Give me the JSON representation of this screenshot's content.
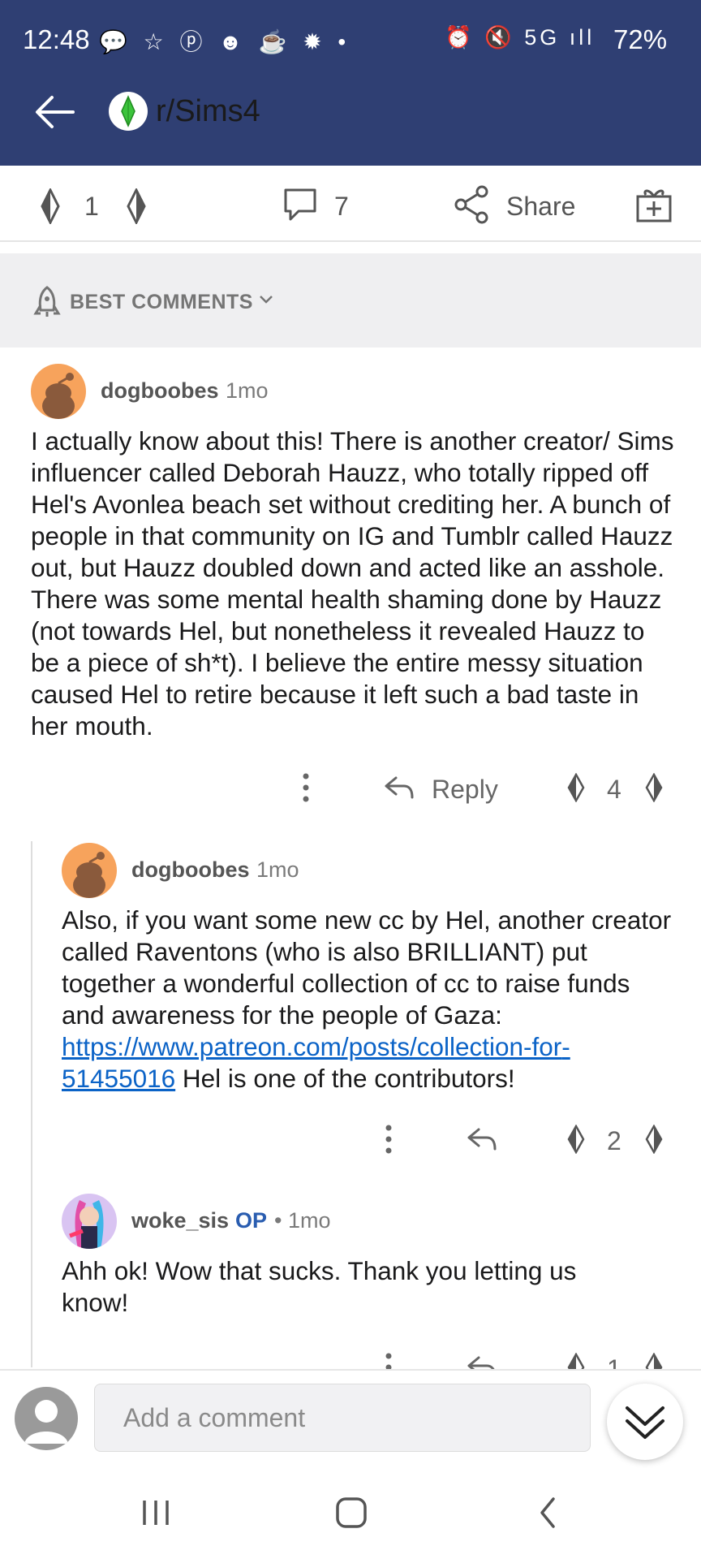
{
  "status_bar": {
    "time": "12:48",
    "left_icons": "💬 ☆ ⓟ ☻ ☕ ✹ •",
    "right_icons": "⏰ 🔇 5G ıll",
    "battery": "72%"
  },
  "header": {
    "subreddit": "r/Sims4",
    "icons": [
      "back-arrow-icon",
      "plumbob-icon"
    ]
  },
  "action_bar": {
    "vote_count": "1",
    "comment_count": "7",
    "share_label": "Share"
  },
  "sort": {
    "label": "BEST COMMENTS"
  },
  "comments": [
    {
      "username": "dogboobes",
      "time": "1mo",
      "body": "I actually know about this! There is another creator/ Sims influencer called Deborah Hauzz, who totally ripped off Hel's Avonlea beach set without crediting her. A bunch of people in that community on IG and Tumblr called Hauzz out, but Hauzz doubled down and acted like an asshole. There was some mental health shaming done by Hauzz (not towards Hel, but nonetheless it revealed Hauzz to be a piece of sh*t). I believe the entire messy situation caused Hel to retire because it left such a bad taste in her mouth.",
      "reply_label": "Reply",
      "votes": "4"
    },
    {
      "username": "dogboobes",
      "time": "1mo",
      "body_before": "Also, if you want some new cc by Hel, another creator called Raventons (who is also BRILLIANT) put together a wonderful collection of cc to raise funds and awareness for the people of Gaza: ",
      "link_line1": "https://www.patreon.com/posts/collection-for",
      "link_line2": "-51455016",
      "body_after": " Hel is one of the contributors!",
      "votes": "2"
    },
    {
      "username": "woke_sis",
      "op_badge": "OP",
      "time": "• 1mo",
      "body": "Ahh ok! Wow that sucks. Thank you letting us know!",
      "votes": "1"
    }
  ],
  "comment_input": {
    "placeholder": "Add a comment"
  },
  "colors": {
    "header_bg": "#2f3f73",
    "link": "#0b63c7",
    "op_badge": "#2a5db0",
    "avatar_orange": "#f7a35c"
  }
}
